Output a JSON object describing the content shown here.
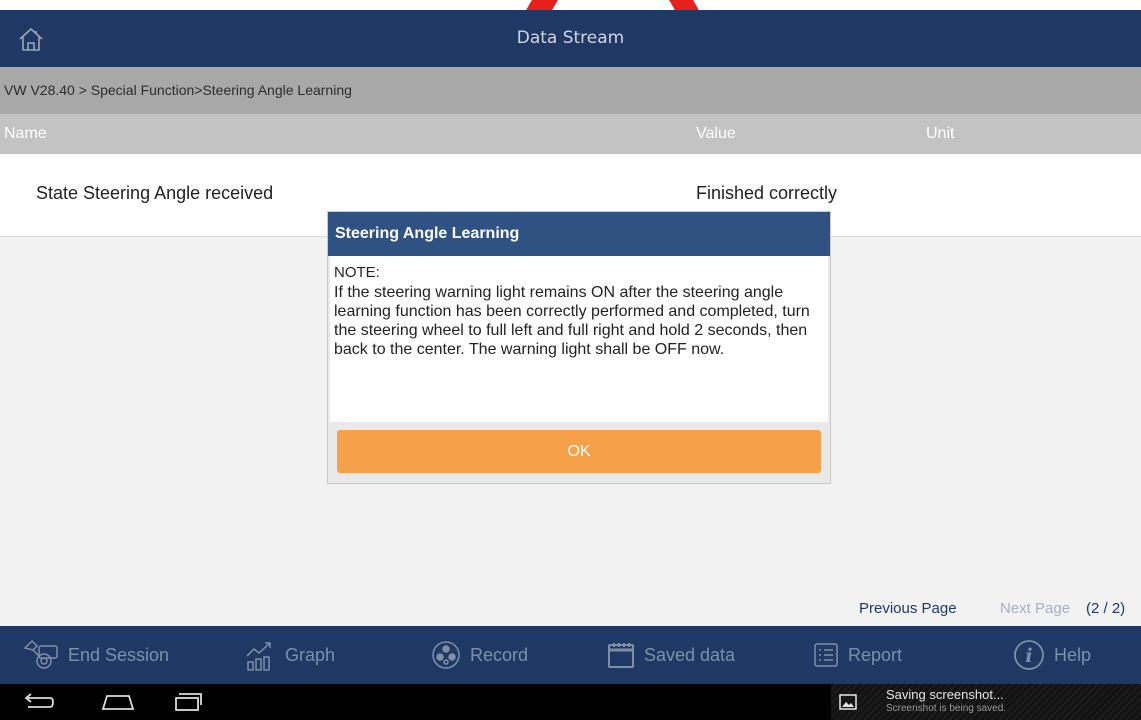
{
  "window": {
    "title": "Data Stream"
  },
  "breadcrumb": "VW V28.40 > Special Function>Steering Angle Learning",
  "table": {
    "headers": [
      "Name",
      "Value",
      "Unit"
    ],
    "rows": [
      {
        "name": "State Steering Angle received",
        "value": "Finished correctly",
        "unit": ""
      }
    ]
  },
  "pager": {
    "previous_label": "Previous Page",
    "next_label": "Next Page",
    "page_count": "(2 / 2)"
  },
  "toolbar": {
    "items": [
      {
        "label": "End Session",
        "icon": "end-session-icon"
      },
      {
        "label": "Graph",
        "icon": "graph-icon"
      },
      {
        "label": "Record",
        "icon": "record-icon"
      },
      {
        "label": "Saved data",
        "icon": "saved-data-icon"
      },
      {
        "label": "Report",
        "icon": "report-icon"
      },
      {
        "label": "Help",
        "icon": "help-icon"
      }
    ]
  },
  "dialog": {
    "title": "Steering Angle Learning",
    "note_label": "NOTE:",
    "message": "If the steering warning light remains ON after the steering angle learning function has been correctly performed and completed, turn the steering wheel to full left and full right and hold 2 seconds, then back to the center. The warning light shall be OFF now.",
    "ok_label": "OK"
  },
  "notification": {
    "title": "Saving screenshot...",
    "subtitle": "Screenshot is being saved.",
    "icon": "image-icon"
  },
  "colors": {
    "titlebar": "#1f3864",
    "dialog_header": "#2f5283",
    "ok_button": "#f7a04a",
    "breadcrumb_bg": "#a8a8a8",
    "header_bg": "#c3c3c3"
  }
}
